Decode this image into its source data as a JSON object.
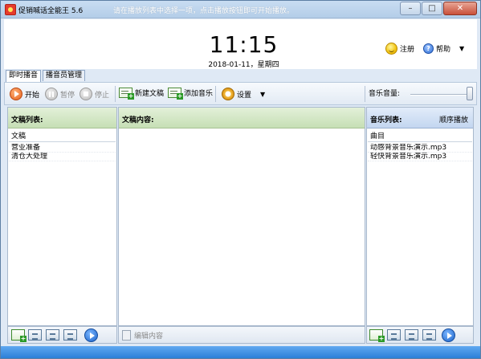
{
  "window": {
    "title": "促销喊话全能王 5.6",
    "marquee": "请在播放列表中选择一项，点击播放按钮即可开始播放。",
    "controls": {
      "minimize": "–",
      "maximize": "□",
      "close": "✕"
    }
  },
  "header": {
    "time": "11:15",
    "date": "2018-01-11，星期四",
    "register_label": "注册",
    "help_label": "帮助",
    "help_caret": "▼"
  },
  "tabs": [
    {
      "label": "即时播音",
      "active": true
    },
    {
      "label": "播音员管理",
      "active": false
    }
  ],
  "toolbar": {
    "start": "开始",
    "pause": "暂停",
    "stop": "停止",
    "new_doc": "新建文稿",
    "add_music": "添加音乐",
    "settings": "设置",
    "settings_caret": "▼",
    "volume_label": "音乐音量:",
    "volume_level": 1.0
  },
  "left_panel": {
    "title": "文稿列表:",
    "column": "文稿",
    "items": [
      "营业准备",
      "清仓大处理"
    ]
  },
  "middle_panel": {
    "title": "文稿内容:",
    "edit_label": "编辑内容"
  },
  "right_panel": {
    "title": "音乐列表:",
    "order_label": "顺序播放",
    "column": "曲目",
    "items": [
      "动感背景音乐演示.mp3",
      "轻快背景音乐演示.mp3"
    ]
  },
  "colors": {
    "accent_blue": "#2c7fd8",
    "green_header": "#c6dfb5",
    "blue_header": "#c3d6f0",
    "start_orange": "#e5601a"
  }
}
